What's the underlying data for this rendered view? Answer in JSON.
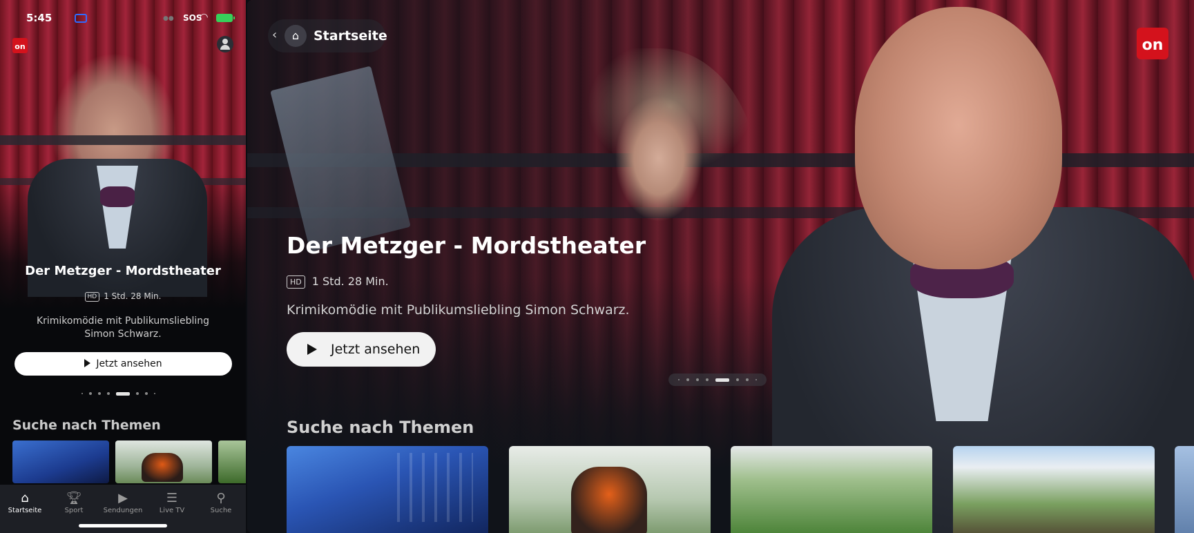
{
  "phone": {
    "status": {
      "time": "5:45",
      "carrier": "SOS"
    },
    "logo_text": "on",
    "hero": {
      "title": "Der Metzger - Mordstheater",
      "hd": "HD",
      "duration": "1 Std. 28 Min.",
      "description": "Krimikomödie mit Publikumsliebling Simon Schwarz.",
      "cta": "Jetzt ansehen"
    },
    "section_title": "Suche nach Themen",
    "tabs": [
      {
        "label": "Startseite",
        "icon": "home-icon",
        "active": true
      },
      {
        "label": "Sport",
        "icon": "trophy-icon",
        "active": false
      },
      {
        "label": "Sendungen",
        "icon": "play-box-icon",
        "active": false
      },
      {
        "label": "Live TV",
        "icon": "list-icon",
        "active": false
      },
      {
        "label": "Suche",
        "icon": "search-icon",
        "active": false
      }
    ]
  },
  "tablet": {
    "nav_label": "Startseite",
    "logo_text": "on",
    "hero": {
      "title": "Der Metzger - Mordstheater",
      "hd": "HD",
      "duration": "1 Std. 28 Min.",
      "description": "Krimikomödie mit Publikumsliebling Simon Schwarz.",
      "cta": "Jetzt ansehen"
    },
    "carousel": {
      "total": 9,
      "active_index": 5
    },
    "section_title": "Suche nach Themen"
  },
  "colors": {
    "brand_red": "#d4121c",
    "background": "#101319",
    "cta_bg": "#ffffff"
  }
}
